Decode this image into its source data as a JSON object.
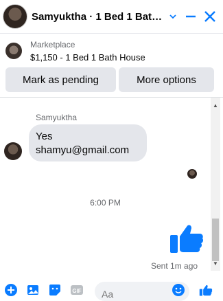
{
  "header": {
    "title": "Samyuktha · 1 Bed 1 Bath ...",
    "accent_color": "#0a7cff",
    "icons": [
      "chevron-down-icon",
      "minimize-icon",
      "close-icon"
    ]
  },
  "listing": {
    "category": "Marketplace",
    "title": "$1,150 - 1 Bed 1 Bath House"
  },
  "actions": {
    "mark_pending_label": "Mark as pending",
    "more_options_label": "More options"
  },
  "conversation": {
    "sender_name": "Samyuktha",
    "message_line1": "Yes",
    "message_line2": "shamyu@gmail.com",
    "timestamp": "6:00 PM",
    "sent_status": "Sent 1m ago"
  },
  "composer": {
    "placeholder": "Aa",
    "icons": [
      "plus-icon",
      "photo-icon",
      "sticker-icon",
      "gif-icon",
      "emoji-icon",
      "like-icon"
    ],
    "gif_label": "GIF"
  }
}
